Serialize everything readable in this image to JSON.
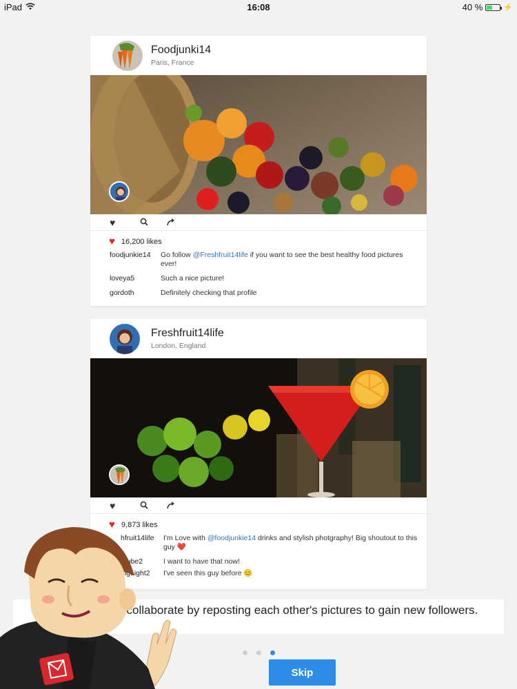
{
  "status_bar": {
    "device": "iPad",
    "time": "16:08",
    "battery": "40 %",
    "battery_level": 0.4
  },
  "posts": [
    {
      "username": "Foodjunki14",
      "location": "Paris, France",
      "likes": "16,200 likes",
      "comments": [
        {
          "user": "foodjunkie14",
          "pre": "Go follow ",
          "mention": "@Freshfruit14life",
          "post": " if you want to see the best healthy food pictures ever!"
        },
        {
          "user": "loveya5",
          "pre": "Such a nice picture!",
          "mention": "",
          "post": ""
        },
        {
          "user": "gordoth",
          "pre": "Definitely checking that profile",
          "mention": "",
          "post": ""
        }
      ]
    },
    {
      "username": "Freshfruit14life",
      "location": "London, England",
      "likes": "9,873 likes",
      "comments": [
        {
          "user": "hfruit14life",
          "pre": "I'm Love with ",
          "mention": "@foodjunkie14",
          "post": " drinks and stylish photgraphy! Big shoutout to this guy ❤️"
        },
        {
          "user": "utube2",
          "pre": "I want to have that now!",
          "mention": "",
          "post": ""
        },
        {
          "user": "ingLight2",
          "pre": "I've seen this guy before 😊",
          "mention": "",
          "post": ""
        }
      ]
    }
  ],
  "banner": {
    "text": "V         agrammers collaborate by reposting each other's pictures to gain new followers."
  },
  "pager": {
    "count": 3,
    "active": 3
  },
  "skip_label": "Skip",
  "colors": {
    "accent": "#2c8de6",
    "like": "#e0282e",
    "mention": "#3a6fb0"
  },
  "icons": [
    "wifi-icon",
    "battery-icon",
    "heart-icon",
    "search-icon",
    "share-icon",
    "mail-icon"
  ]
}
